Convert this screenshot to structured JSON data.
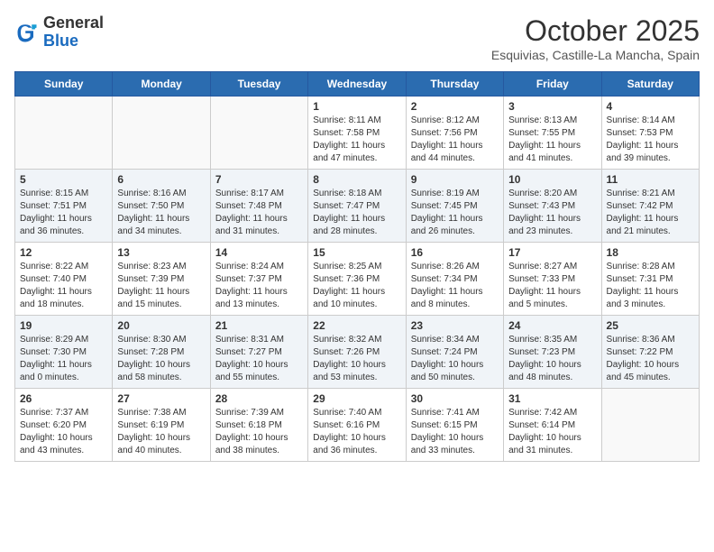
{
  "logo": {
    "general": "General",
    "blue": "Blue"
  },
  "header": {
    "month": "October 2025",
    "location": "Esquivias, Castille-La Mancha, Spain"
  },
  "days_of_week": [
    "Sunday",
    "Monday",
    "Tuesday",
    "Wednesday",
    "Thursday",
    "Friday",
    "Saturday"
  ],
  "weeks": [
    [
      {
        "day": "",
        "info": ""
      },
      {
        "day": "",
        "info": ""
      },
      {
        "day": "",
        "info": ""
      },
      {
        "day": "1",
        "info": "Sunrise: 8:11 AM\nSunset: 7:58 PM\nDaylight: 11 hours and 47 minutes."
      },
      {
        "day": "2",
        "info": "Sunrise: 8:12 AM\nSunset: 7:56 PM\nDaylight: 11 hours and 44 minutes."
      },
      {
        "day": "3",
        "info": "Sunrise: 8:13 AM\nSunset: 7:55 PM\nDaylight: 11 hours and 41 minutes."
      },
      {
        "day": "4",
        "info": "Sunrise: 8:14 AM\nSunset: 7:53 PM\nDaylight: 11 hours and 39 minutes."
      }
    ],
    [
      {
        "day": "5",
        "info": "Sunrise: 8:15 AM\nSunset: 7:51 PM\nDaylight: 11 hours and 36 minutes."
      },
      {
        "day": "6",
        "info": "Sunrise: 8:16 AM\nSunset: 7:50 PM\nDaylight: 11 hours and 34 minutes."
      },
      {
        "day": "7",
        "info": "Sunrise: 8:17 AM\nSunset: 7:48 PM\nDaylight: 11 hours and 31 minutes."
      },
      {
        "day": "8",
        "info": "Sunrise: 8:18 AM\nSunset: 7:47 PM\nDaylight: 11 hours and 28 minutes."
      },
      {
        "day": "9",
        "info": "Sunrise: 8:19 AM\nSunset: 7:45 PM\nDaylight: 11 hours and 26 minutes."
      },
      {
        "day": "10",
        "info": "Sunrise: 8:20 AM\nSunset: 7:43 PM\nDaylight: 11 hours and 23 minutes."
      },
      {
        "day": "11",
        "info": "Sunrise: 8:21 AM\nSunset: 7:42 PM\nDaylight: 11 hours and 21 minutes."
      }
    ],
    [
      {
        "day": "12",
        "info": "Sunrise: 8:22 AM\nSunset: 7:40 PM\nDaylight: 11 hours and 18 minutes."
      },
      {
        "day": "13",
        "info": "Sunrise: 8:23 AM\nSunset: 7:39 PM\nDaylight: 11 hours and 15 minutes."
      },
      {
        "day": "14",
        "info": "Sunrise: 8:24 AM\nSunset: 7:37 PM\nDaylight: 11 hours and 13 minutes."
      },
      {
        "day": "15",
        "info": "Sunrise: 8:25 AM\nSunset: 7:36 PM\nDaylight: 11 hours and 10 minutes."
      },
      {
        "day": "16",
        "info": "Sunrise: 8:26 AM\nSunset: 7:34 PM\nDaylight: 11 hours and 8 minutes."
      },
      {
        "day": "17",
        "info": "Sunrise: 8:27 AM\nSunset: 7:33 PM\nDaylight: 11 hours and 5 minutes."
      },
      {
        "day": "18",
        "info": "Sunrise: 8:28 AM\nSunset: 7:31 PM\nDaylight: 11 hours and 3 minutes."
      }
    ],
    [
      {
        "day": "19",
        "info": "Sunrise: 8:29 AM\nSunset: 7:30 PM\nDaylight: 11 hours and 0 minutes."
      },
      {
        "day": "20",
        "info": "Sunrise: 8:30 AM\nSunset: 7:28 PM\nDaylight: 10 hours and 58 minutes."
      },
      {
        "day": "21",
        "info": "Sunrise: 8:31 AM\nSunset: 7:27 PM\nDaylight: 10 hours and 55 minutes."
      },
      {
        "day": "22",
        "info": "Sunrise: 8:32 AM\nSunset: 7:26 PM\nDaylight: 10 hours and 53 minutes."
      },
      {
        "day": "23",
        "info": "Sunrise: 8:34 AM\nSunset: 7:24 PM\nDaylight: 10 hours and 50 minutes."
      },
      {
        "day": "24",
        "info": "Sunrise: 8:35 AM\nSunset: 7:23 PM\nDaylight: 10 hours and 48 minutes."
      },
      {
        "day": "25",
        "info": "Sunrise: 8:36 AM\nSunset: 7:22 PM\nDaylight: 10 hours and 45 minutes."
      }
    ],
    [
      {
        "day": "26",
        "info": "Sunrise: 7:37 AM\nSunset: 6:20 PM\nDaylight: 10 hours and 43 minutes."
      },
      {
        "day": "27",
        "info": "Sunrise: 7:38 AM\nSunset: 6:19 PM\nDaylight: 10 hours and 40 minutes."
      },
      {
        "day": "28",
        "info": "Sunrise: 7:39 AM\nSunset: 6:18 PM\nDaylight: 10 hours and 38 minutes."
      },
      {
        "day": "29",
        "info": "Sunrise: 7:40 AM\nSunset: 6:16 PM\nDaylight: 10 hours and 36 minutes."
      },
      {
        "day": "30",
        "info": "Sunrise: 7:41 AM\nSunset: 6:15 PM\nDaylight: 10 hours and 33 minutes."
      },
      {
        "day": "31",
        "info": "Sunrise: 7:42 AM\nSunset: 6:14 PM\nDaylight: 10 hours and 31 minutes."
      },
      {
        "day": "",
        "info": ""
      }
    ]
  ]
}
